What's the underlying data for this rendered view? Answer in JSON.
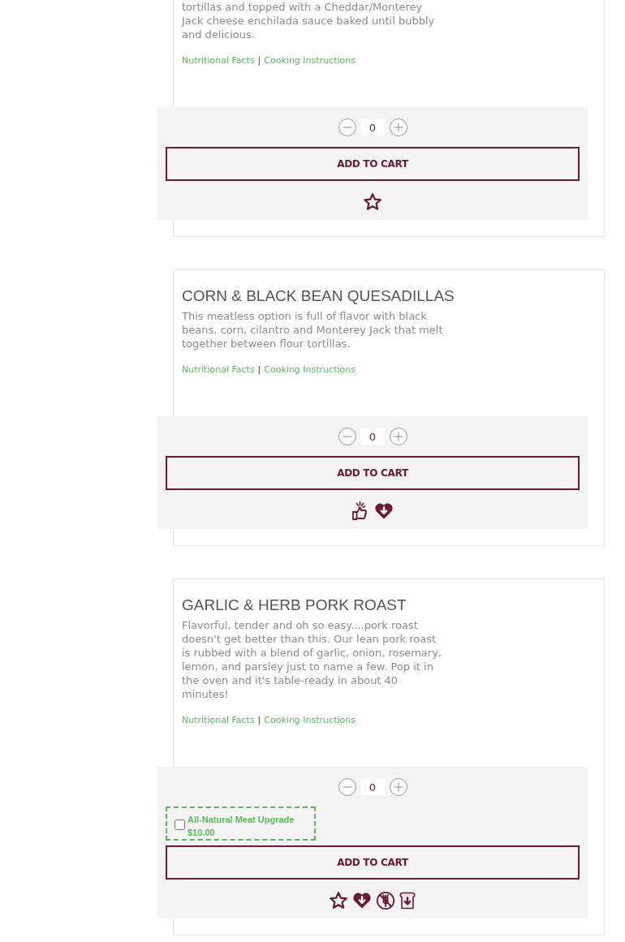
{
  "products": [
    {
      "description": "tortillas and topped with a Cheddar/Monterey Jack cheese enchilada sauce baked until bubbly and delicious.",
      "links": [
        {
          "label": "Nutritional Facts"
        },
        {
          "label": "Cooking Instructions"
        }
      ],
      "link_separator": "|",
      "quantity": "0",
      "add_to_cart": "ADD TO CART",
      "badges": [
        {
          "kind": "star"
        }
      ]
    },
    {
      "title": "CORN & BLACK BEAN QUESADILLAS",
      "description": "This meatless option is full of flavor with black beans, corn, cilantro and Monterey Jack that melt together between flour tortillas.",
      "links": [
        {
          "label": "Nutritional Facts"
        },
        {
          "label": "Cooking Instructions"
        }
      ],
      "link_separator": "|",
      "quantity": "0",
      "add_to_cart": "ADD TO CART",
      "badges": [
        {
          "kind": "thumbs_up"
        },
        {
          "kind": "heart"
        }
      ]
    },
    {
      "title": "GARLIC & HERB PORK ROAST",
      "description": "Flavorful, tender and oh so easy....pork roast doesn't get better than this. Our lean pork roast is rubbed with a blend of garlic, onion, rosemary, lemon, and parsley just to name a few. Pop it in the oven and it's table-ready in about 40 minutes!",
      "links": [
        {
          "label": "Nutritional Facts"
        },
        {
          "label": "Cooking Instructions"
        }
      ],
      "link_separator": "|",
      "quantity": "0",
      "upgrade": {
        "label": "All-Natural Meat Upgrade",
        "price": "$10.00",
        "checked": false
      },
      "add_to_cart": "ADD TO CART",
      "badges": [
        {
          "kind": "star"
        },
        {
          "kind": "heart"
        },
        {
          "kind": "no_wheat"
        },
        {
          "kind": "bread"
        }
      ]
    }
  ]
}
